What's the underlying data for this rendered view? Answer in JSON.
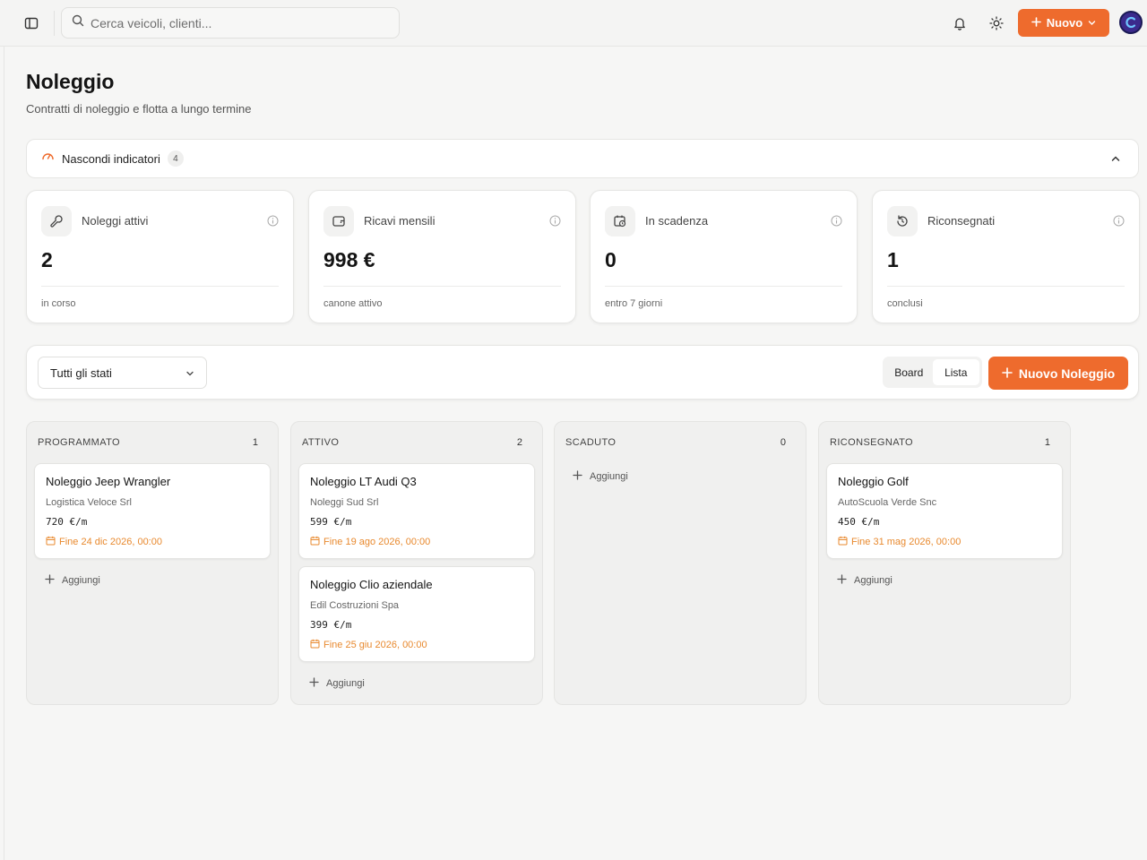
{
  "header": {
    "search_placeholder": "Cerca veicoli, clienti...",
    "new_button_label": "Nuovo"
  },
  "page": {
    "title": "Noleggio",
    "subtitle": "Contratti di noleggio e flotta a lungo termine"
  },
  "indicators": {
    "toggle_label": "Nascondi indicatori",
    "count": "4"
  },
  "kpis": [
    {
      "title": "Noleggi attivi",
      "value": "2",
      "footer": "in corso",
      "icon": "wrench-icon"
    },
    {
      "title": "Ricavi mensili",
      "value": "998 €",
      "footer": "canone attivo",
      "icon": "wallet-icon"
    },
    {
      "title": "In scadenza",
      "value": "0",
      "footer": "entro 7 giorni",
      "icon": "calendar-clock-icon"
    },
    {
      "title": "Riconsegnati",
      "value": "1",
      "footer": "conclusi",
      "icon": "rotate-icon"
    }
  ],
  "toolbar": {
    "status_filter": "Tutti gli stati",
    "view_board": "Board",
    "view_list": "Lista",
    "new_rental_label": "Nuovo Noleggio"
  },
  "columns": [
    {
      "name": "PROGRAMMATO",
      "count": "1",
      "cards": [
        {
          "title": "Noleggio Jeep Wrangler",
          "client": "Logistica Veloce Srl",
          "price": "720 €/m",
          "end": "Fine 24 dic 2026, 00:00"
        }
      ]
    },
    {
      "name": "ATTIVO",
      "count": "2",
      "cards": [
        {
          "title": "Noleggio LT Audi Q3",
          "client": "Noleggi Sud Srl",
          "price": "599 €/m",
          "end": "Fine 19 ago 2026, 00:00"
        },
        {
          "title": "Noleggio Clio aziendale",
          "client": "Edil Costruzioni Spa",
          "price": "399 €/m",
          "end": "Fine 25 giu 2026, 00:00"
        }
      ]
    },
    {
      "name": "SCADUTO",
      "count": "0",
      "cards": []
    },
    {
      "name": "RICONSEGNATO",
      "count": "1",
      "cards": [
        {
          "title": "Noleggio Golf",
          "client": "AutoScuola Verde Snc",
          "price": "450 €/m",
          "end": "Fine 31 mag 2026, 00:00"
        }
      ]
    }
  ],
  "add_label": "Aggiungi",
  "colors": {
    "accent": "#ee6b2d",
    "due_date": "#e8892e",
    "background": "#f6f6f5"
  }
}
